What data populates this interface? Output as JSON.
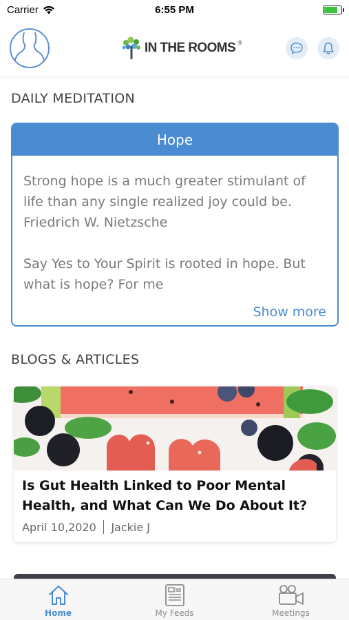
{
  "status_bar": {
    "carrier": "Carrier",
    "time": "6:55 PM",
    "battery_level": 0.8,
    "battery_color": "#3dc43d"
  },
  "header": {
    "logo_text": "IN THE ROOMS",
    "registered_mark": "®",
    "icons": [
      "avatar",
      "chat-bubble-icon",
      "bell-icon"
    ]
  },
  "daily_meditation": {
    "section_title": "DAILY MEDITATION",
    "title": "Hope",
    "quote": "Strong hope is a much greater stimulant of life than any single realized joy could be. Friedrich W. Nietzsche",
    "excerpt": "Say Yes to Your Spirit is rooted in hope. But what is hope? For me",
    "show_more": "Show more"
  },
  "blogs": {
    "section_title": "BLOGS & ARTICLES",
    "articles": [
      {
        "title": "Is Gut Health Linked to Poor Mental Health, and What Can We Do About It?",
        "date": "April 10,2020",
        "author": "Jackie J"
      }
    ]
  },
  "tab_bar": {
    "tabs": [
      {
        "label": "Home",
        "icon": "home-icon",
        "active": true
      },
      {
        "label": "My Feeds",
        "icon": "feed-icon",
        "active": false
      },
      {
        "label": "Meetings",
        "icon": "video-camera-icon",
        "active": false
      }
    ]
  },
  "colors": {
    "accent": "#4a8bd1",
    "tab_active": "#4a8bd1",
    "tab_inactive": "#8a8a8a"
  }
}
